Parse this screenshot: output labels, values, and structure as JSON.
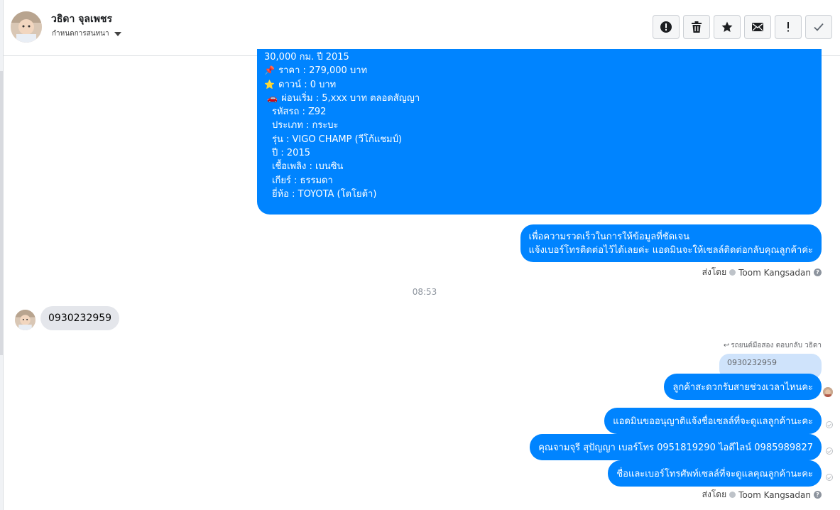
{
  "header": {
    "contact_name": "วธิดา จุลเพชร",
    "subtitle": "กำหนดการสนทนา"
  },
  "toolbar": {
    "buttons": [
      {
        "icon": "alert-circle-icon",
        "label": "Mark as spam"
      },
      {
        "icon": "trash-icon",
        "label": "Delete"
      },
      {
        "icon": "star-icon",
        "label": "Star"
      },
      {
        "icon": "envelope-icon",
        "label": "Mark as unread"
      },
      {
        "icon": "exclamation-icon",
        "label": "Follow up"
      },
      {
        "icon": "check-icon",
        "label": "Mark as done"
      }
    ]
  },
  "listing": {
    "lines": [
      {
        "emoji": "",
        "text": "30,000 กม. ปี 2015"
      },
      {
        "emoji": "📌",
        "text": "ราคา : 279,000 บาท"
      },
      {
        "emoji": "⭐",
        "text": "ดาวน์ : 0 บาท"
      },
      {
        "emoji": "🚗",
        "text": "ผ่อนเริ่ม : 5,xxx บาท ตลอดสัญญา"
      },
      {
        "emoji": "",
        "text": "  รหัสรถ : Z92"
      },
      {
        "emoji": "",
        "text": "  ประเภท : กระบะ"
      },
      {
        "emoji": "",
        "text": "  รุ่น : VIGO CHAMP (วีโก้แชมป์)"
      },
      {
        "emoji": "",
        "text": "  ปี : 2015"
      },
      {
        "emoji": "",
        "text": "  เชื้อเพลิง : เบนซิน"
      },
      {
        "emoji": "",
        "text": "  เกียร์ : ธรรมดา"
      },
      {
        "emoji": "",
        "text": "  ยี่ห้อ : TOYOTA (โตโยต้า)"
      }
    ]
  },
  "messages": {
    "request_phone": {
      "line1": "เพื่อความรวดเร็วในการให้ข้อมูลที่ชัดเจน",
      "line2": "แจ้งเบอร์โทรติดต่อไว้ได้เลยค่ะ แอดมินจะให้เซลล์ติดต่อกลับคุณลูกค้าค่ะ"
    },
    "sent_by_label": "ส่งโดย",
    "sent_by_name": "Toom Kangsadan",
    "timestamp": "08:53",
    "incoming_phone": "0930232959",
    "reply_header": "รถยนต์มือสอง ตอบกลับ วธิดา",
    "reply_quote": "0930232959",
    "ask_time": "ลูกค้าสะดวกรับสายช่วงเวลาไหนคะ",
    "seller_intro": "แอดมินขออนุญาติแจ้งชื่อเซลล์ที่จะดูแลลูกค้านะคะ",
    "seller_contact": "คุณจามจุรี สุปัญญา เบอร์โทร 0951819290  ไอดีไลน์ 0985989827",
    "seller_outro": "ชื่อและเบอร์โทรศัพท์เซลล์ที่จะดูแลคุณลูกค้านะคะ"
  },
  "colors": {
    "outgoing_bubble": "#0084ff",
    "incoming_bubble": "#e4e6eb",
    "reply_quote_bg": "#cfe3fb"
  }
}
